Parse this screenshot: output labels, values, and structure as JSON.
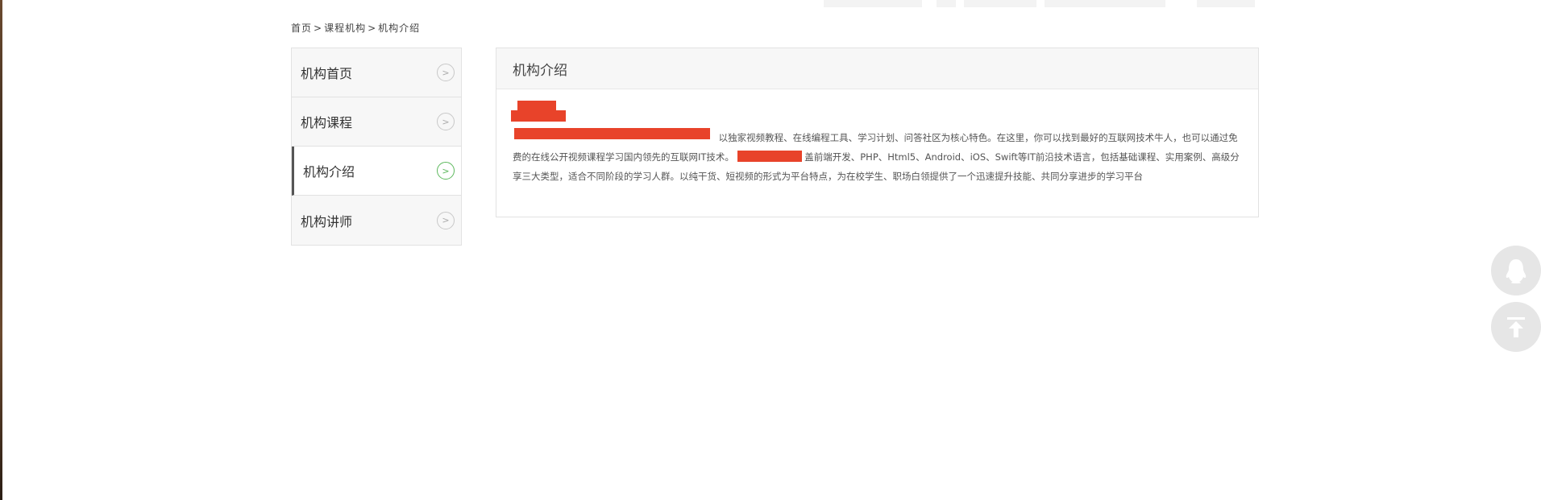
{
  "breadcrumb": {
    "home": "首页",
    "sep1": ">",
    "section": "课程机构",
    "sep2": ">",
    "current": "机构介绍"
  },
  "sidebar": {
    "items": [
      {
        "label": "机构首页",
        "active": false
      },
      {
        "label": "机构课程",
        "active": false
      },
      {
        "label": "机构介绍",
        "active": true
      },
      {
        "label": "机构讲师",
        "active": false
      }
    ],
    "arrow_icon": "chevron-right-circle-icon"
  },
  "panel": {
    "title": "机构介绍",
    "intro_part1": "以独家视频教程、在线编程工具、学习计划、问答社区为核心特色。在这里，你可以找到最好的互联网技术牛人，也可以通过免费的在线公开视频课程学习国内领先的互联网IT技术。",
    "intro_part2": "盖前端开发、PHP、Html5、Android、iOS、Swift等IT前沿技术语言，包括基础课程、实用案例、高级分享三大类型，适合不同阶段的学习人群。以纯干货、短视频的形式为平台特点，为在校学生、职场白领提供了一个迅速提升技能、共同分享进步的学习平台"
  },
  "float_buttons": {
    "qq_icon": "qq-penguin-icon",
    "top_icon": "back-to-top-icon"
  },
  "colors": {
    "active_arrow": "#5cb85c",
    "redaction": "#e8432a",
    "panel_head_bg": "#f7f7f7"
  }
}
